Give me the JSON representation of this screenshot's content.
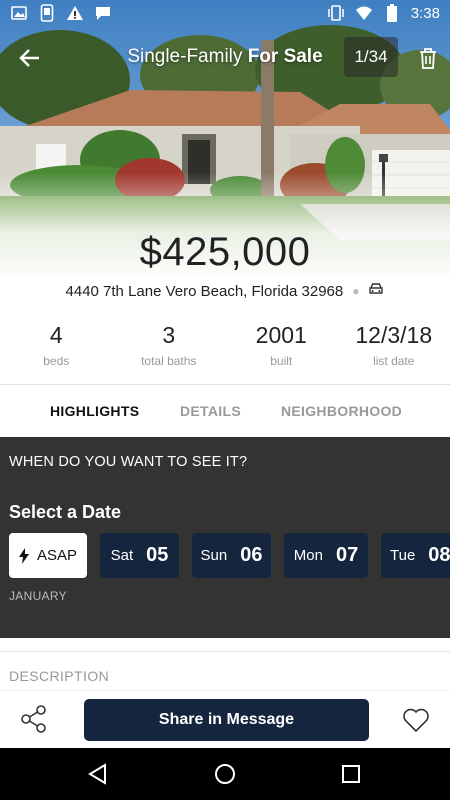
{
  "status_bar": {
    "time": "3:38",
    "left_icons": [
      "image-icon",
      "phone-notification-icon",
      "warning-icon",
      "chat-bubble-icon"
    ],
    "right_icons": [
      "vibrate-icon",
      "wifi-icon",
      "battery-icon"
    ]
  },
  "header": {
    "title_prefix": "Single-Family",
    "title_suffix": "For Sale",
    "photo_counter": "1/34"
  },
  "listing": {
    "price": "$425,000",
    "address": "4440 7th Lane Vero Beach, Florida 32968",
    "stats": [
      {
        "value": "4",
        "label": "beds"
      },
      {
        "value": "3",
        "label": "total baths"
      },
      {
        "value": "2001",
        "label": "built"
      },
      {
        "value": "12/3/18",
        "label": "list date"
      }
    ]
  },
  "tabs": [
    {
      "label": "HIGHLIGHTS",
      "active": true
    },
    {
      "label": "DETAILS",
      "active": false
    },
    {
      "label": "NEIGHBORHOOD",
      "active": false
    }
  ],
  "schedule": {
    "question": "WHEN DO YOU WANT TO SEE IT?",
    "select_date": "Select a Date",
    "asap_label": "ASAP",
    "dates": [
      {
        "dow": "Sat",
        "day": "05"
      },
      {
        "dow": "Sun",
        "day": "06"
      },
      {
        "dow": "Mon",
        "day": "07"
      },
      {
        "dow": "Tue",
        "day": "08"
      }
    ],
    "month": "JANUARY"
  },
  "description_heading": "DESCRIPTION",
  "actions": {
    "share_message": "Share in Message"
  },
  "colors": {
    "navy": "#14253d",
    "schedule_bg": "#333333"
  }
}
